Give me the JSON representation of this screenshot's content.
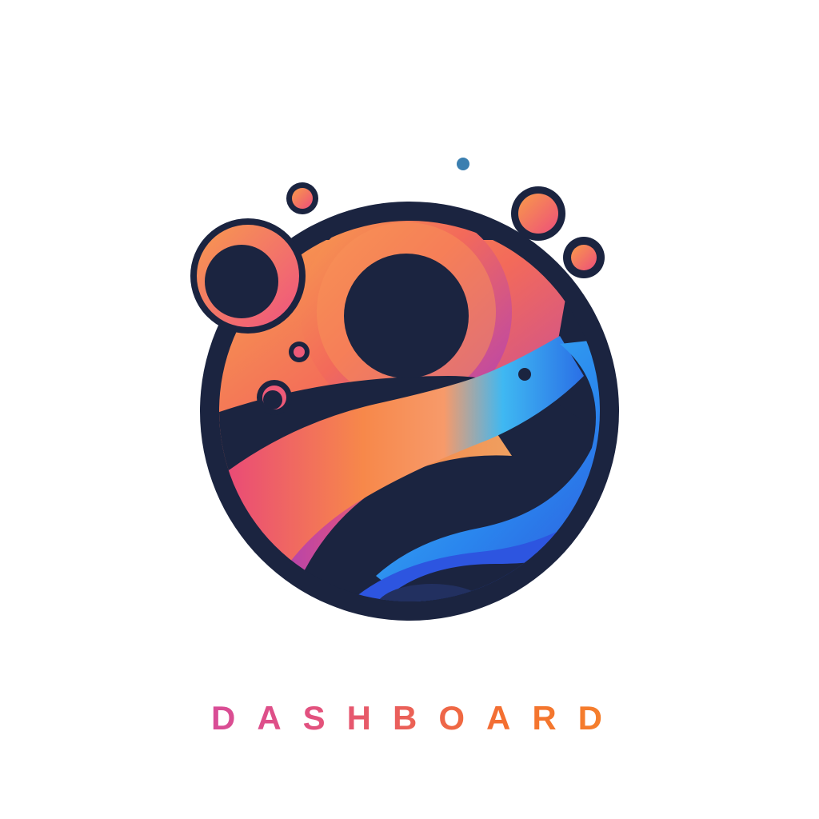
{
  "brand": {
    "wordmark": "DASHBOARD",
    "logo_icon": "abstract-orb-wave-logo",
    "colors": {
      "navy": "#1b2440",
      "orange": "#f7884a",
      "pink": "#ee5585",
      "purple": "#8b3ec6",
      "blue": "#2e8df0",
      "cyan": "#39c6f2",
      "background": "#ffffff"
    }
  }
}
